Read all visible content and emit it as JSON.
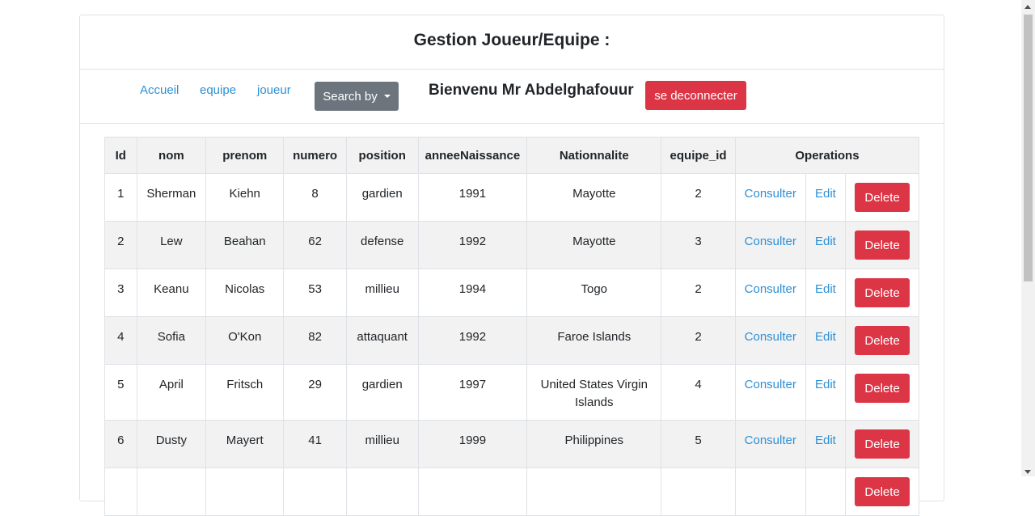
{
  "header": {
    "title": "Gestion Joueur/Equipe :"
  },
  "nav": {
    "links": [
      "Accueil",
      "equipe",
      "joueur"
    ],
    "search_label": "Search by",
    "welcome": "Bienvenu Mr Abdelghafouur",
    "logout_label": "se deconnecter"
  },
  "table": {
    "columns": [
      "Id",
      "nom",
      "prenom",
      "numero",
      "position",
      "anneeNaissance",
      "Nationnalite",
      "equipe_id",
      "Operations"
    ],
    "rows": [
      {
        "id": "1",
        "nom": "Sherman",
        "prenom": "Kiehn",
        "numero": "8",
        "position": "gardien",
        "annee": "1991",
        "nationalite": "Mayotte",
        "equipe_id": "2"
      },
      {
        "id": "2",
        "nom": "Lew",
        "prenom": "Beahan",
        "numero": "62",
        "position": "defense",
        "annee": "1992",
        "nationalite": "Mayotte",
        "equipe_id": "3"
      },
      {
        "id": "3",
        "nom": "Keanu",
        "prenom": "Nicolas",
        "numero": "53",
        "position": "millieu",
        "annee": "1994",
        "nationalite": "Togo",
        "equipe_id": "2"
      },
      {
        "id": "4",
        "nom": "Sofia",
        "prenom": "O'Kon",
        "numero": "82",
        "position": "attaquant",
        "annee": "1992",
        "nationalite": "Faroe Islands",
        "equipe_id": "2"
      },
      {
        "id": "5",
        "nom": "April",
        "prenom": "Fritsch",
        "numero": "29",
        "position": "gardien",
        "annee": "1997",
        "nationalite": "United States Virgin Islands",
        "equipe_id": "4"
      },
      {
        "id": "6",
        "nom": "Dusty",
        "prenom": "Mayert",
        "numero": "41",
        "position": "millieu",
        "annee": "1999",
        "nationalite": "Philippines",
        "equipe_id": "5"
      },
      {
        "id": "",
        "nom": "",
        "prenom": "",
        "numero": "",
        "position": "",
        "annee": "",
        "nationalite": "",
        "equipe_id": ""
      }
    ],
    "ops": {
      "consult": "Consulter",
      "edit": "Edit",
      "delete": "Delete"
    }
  },
  "colors": {
    "primary_link": "#2d8fd5",
    "danger": "#dc3545",
    "secondary": "#6c757d"
  }
}
